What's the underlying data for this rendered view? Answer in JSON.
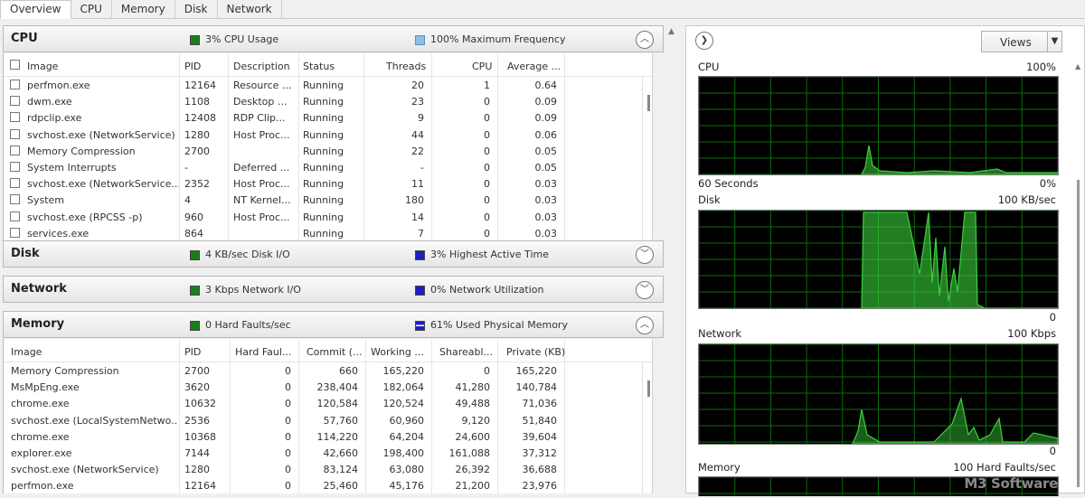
{
  "tabs": [
    "Overview",
    "CPU",
    "Memory",
    "Disk",
    "Network"
  ],
  "cpu_section": {
    "title": "CPU",
    "stat1": "3% CPU Usage",
    "stat2": "100% Maximum Frequency",
    "stat1_color": "#1a7f1a",
    "stat2_color": "#8fbfe8"
  },
  "cpu_table": {
    "columns": [
      "Image",
      "PID",
      "Description",
      "Status",
      "Threads",
      "CPU",
      "Average ..."
    ],
    "rows": [
      [
        "perfmon.exe",
        "12164",
        "Resource ...",
        "Running",
        "20",
        "1",
        "0.64"
      ],
      [
        "dwm.exe",
        "1108",
        "Desktop ...",
        "Running",
        "23",
        "0",
        "0.09"
      ],
      [
        "rdpclip.exe",
        "12408",
        "RDP Clip...",
        "Running",
        "9",
        "0",
        "0.09"
      ],
      [
        "svchost.exe (NetworkService)",
        "1280",
        "Host Proc...",
        "Running",
        "44",
        "0",
        "0.06"
      ],
      [
        "Memory Compression",
        "2700",
        "",
        "Running",
        "22",
        "0",
        "0.05"
      ],
      [
        "System Interrupts",
        "-",
        "Deferred ...",
        "Running",
        "-",
        "0",
        "0.05"
      ],
      [
        "svchost.exe (NetworkService...",
        "2352",
        "Host Proc...",
        "Running",
        "11",
        "0",
        "0.03"
      ],
      [
        "System",
        "4",
        "NT Kernel...",
        "Running",
        "180",
        "0",
        "0.03"
      ],
      [
        "svchost.exe (RPCSS -p)",
        "960",
        "Host Proc...",
        "Running",
        "14",
        "0",
        "0.03"
      ],
      [
        "services.exe",
        "864",
        "",
        "Running",
        "7",
        "0",
        "0.03"
      ]
    ]
  },
  "disk_section": {
    "title": "Disk",
    "stat1": "4 KB/sec Disk I/O",
    "stat2": "3% Highest Active Time",
    "stat1_color": "#1a7f1a",
    "stat2_color": "#1f1fc0"
  },
  "network_section": {
    "title": "Network",
    "stat1": "3 Kbps Network I/O",
    "stat2": "0% Network Utilization",
    "stat1_color": "#1a7f1a",
    "stat2_color": "#1f1fc0"
  },
  "memory_section": {
    "title": "Memory",
    "stat1": "0 Hard Faults/sec",
    "stat2": "61% Used Physical Memory",
    "stat1_color": "#1a7f1a",
    "stat2_color": "#1f1fc0"
  },
  "memory_table": {
    "columns": [
      "Image",
      "PID",
      "Hard Faul...",
      "Commit (...",
      "Working ...",
      "Shareabl...",
      "Private (KB)"
    ],
    "rows": [
      [
        "Memory Compression",
        "2700",
        "0",
        "660",
        "165,220",
        "0",
        "165,220"
      ],
      [
        "MsMpEng.exe",
        "3620",
        "0",
        "238,404",
        "182,064",
        "41,280",
        "140,784"
      ],
      [
        "chrome.exe",
        "10632",
        "0",
        "120,584",
        "120,524",
        "49,488",
        "71,036"
      ],
      [
        "svchost.exe (LocalSystemNetwo...",
        "2536",
        "0",
        "57,760",
        "60,960",
        "9,120",
        "51,840"
      ],
      [
        "chrome.exe",
        "10368",
        "0",
        "114,220",
        "64,204",
        "24,600",
        "39,604"
      ],
      [
        "explorer.exe",
        "7144",
        "0",
        "42,660",
        "198,400",
        "161,088",
        "37,312"
      ],
      [
        "svchost.exe (NetworkService)",
        "1280",
        "0",
        "83,124",
        "63,080",
        "26,392",
        "36,688"
      ],
      [
        "perfmon.exe",
        "12164",
        "0",
        "25,460",
        "45,176",
        "21,200",
        "23,976"
      ]
    ]
  },
  "right_panel": {
    "views_label": "Views",
    "cpu_graph": {
      "label": "CPU",
      "max": "100%",
      "time": "60 Seconds",
      "min": "0%"
    },
    "disk_graph": {
      "label": "Disk",
      "max": "100 KB/sec",
      "min": "0"
    },
    "network_graph": {
      "label": "Network",
      "max": "100 Kbps",
      "min": "0"
    },
    "memory_graph": {
      "label": "Memory",
      "max": "100 Hard Faults/sec"
    }
  },
  "graph_color": "#3bd13b",
  "watermark": "M3 Software"
}
